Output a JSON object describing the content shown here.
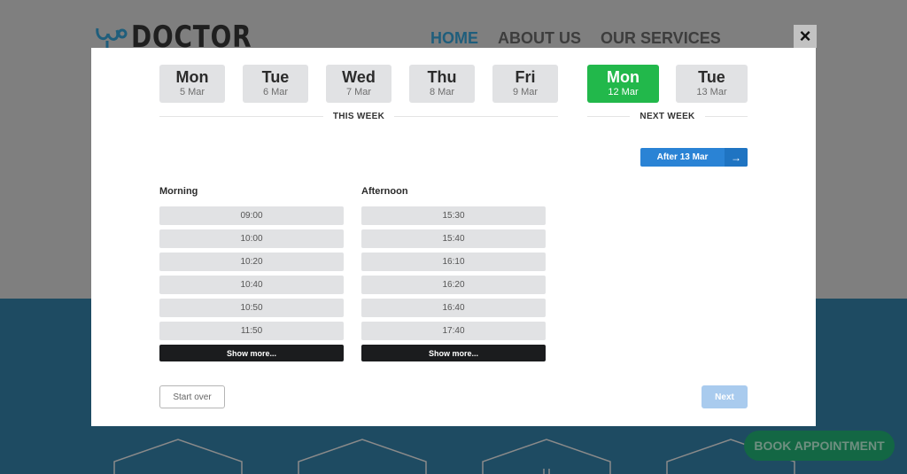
{
  "background": {
    "logo_text": "DOCTOR",
    "nav": [
      {
        "label": "HOME",
        "active": true
      },
      {
        "label": "ABOUT US",
        "active": false
      },
      {
        "label": "OUR SERVICES",
        "active": false
      }
    ],
    "book_appointment_label": "BOOK APPOINTMENT"
  },
  "modal": {
    "close_icon": "×",
    "this_week": {
      "label": "THIS WEEK",
      "days": [
        {
          "name": "Mon",
          "date": "5 Mar",
          "selected": false
        },
        {
          "name": "Tue",
          "date": "6 Mar",
          "selected": false
        },
        {
          "name": "Wed",
          "date": "7 Mar",
          "selected": false
        },
        {
          "name": "Thu",
          "date": "8 Mar",
          "selected": false
        },
        {
          "name": "Fri",
          "date": "9 Mar",
          "selected": false
        }
      ]
    },
    "next_week": {
      "label": "NEXT WEEK",
      "days": [
        {
          "name": "Mon",
          "date": "12 Mar",
          "selected": true
        },
        {
          "name": "Tue",
          "date": "13 Mar",
          "selected": false
        }
      ]
    },
    "after_button": {
      "label": "After 13 Mar",
      "icon": "→"
    },
    "morning": {
      "title": "Morning",
      "slots": [
        "09:00",
        "10:00",
        "10:20",
        "10:40",
        "10:50",
        "11:50"
      ],
      "show_more": "Show more..."
    },
    "afternoon": {
      "title": "Afternoon",
      "slots": [
        "15:30",
        "15:40",
        "16:10",
        "16:20",
        "16:40",
        "17:40"
      ],
      "show_more": "Show more..."
    },
    "start_over_label": "Start over",
    "next_label": "Next",
    "colors": {
      "selected_day": "#22b84b",
      "after_button": "#2a83d5",
      "next_disabled": "#a9cbee",
      "show_more": "#1b1c1e"
    }
  }
}
